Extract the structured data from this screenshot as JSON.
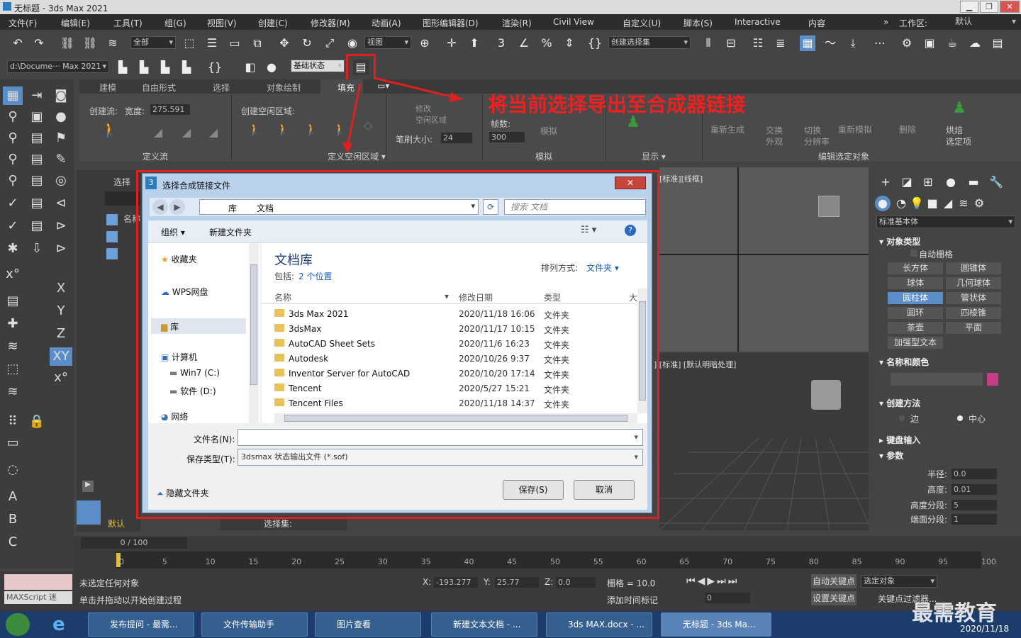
{
  "window": {
    "title": "无标题 - 3ds Max 2021"
  },
  "menu": [
    "文件(F)",
    "编辑(E)",
    "工具(T)",
    "组(G)",
    "视图(V)",
    "创建(C)",
    "修改器(M)",
    "动画(A)",
    "图形编辑器(D)",
    "渲染(R)",
    "Civil View",
    "自定义(U)",
    "脚本(S)",
    "Interactive",
    "内容"
  ],
  "workspace": {
    "label": "工作区:",
    "value": "默认"
  },
  "toolbar1": {
    "filter": "全部",
    "view": "视图",
    "selection_set": "创建选择集"
  },
  "toolbar2": {
    "path": "d:\\Docume··· Max 2021",
    "state": "基础状态"
  },
  "ribbon": {
    "tabs": [
      "建模",
      "自由形式",
      "选择",
      "对象绘制",
      "填充"
    ],
    "create_flow": "创建流:",
    "width_label": "宽度:",
    "width_value": "275.591",
    "create_region": "创建空闲区域:",
    "modify_region": "修改\n空闲区域",
    "brush_label": "笔刷大小:",
    "brush_value": "24",
    "frames_label": "帧数:",
    "frames_value": "300",
    "simulate": "模拟",
    "regen": "重新生成",
    "exchange": "交换\n外观",
    "switch": "切换\n分辨率",
    "resim": "重新模拟",
    "delete": "删除",
    "bake": "烘焙\n选定项",
    "sections": [
      "定义流",
      "定义空闲区域 ▾",
      "模拟",
      "显示 ▾",
      "编辑选定对象"
    ]
  },
  "annotation": "将当前选择导出至合成器链接",
  "dialog": {
    "title": "选择合成链接文件",
    "address": [
      "库",
      "文档"
    ],
    "search_placeholder": "搜索 文档",
    "organize": "组织 ▾",
    "new_folder": "新建文件夹",
    "nav": [
      "收藏夹",
      "WPS网盘",
      "库",
      "计算机",
      "Win7 (C:)",
      "软件 (D:)",
      "网络"
    ],
    "library_title": "文档库",
    "library_includes": "包括:",
    "library_locations": "2 个位置",
    "sort_label": "排列方式:",
    "sort_value": "文件夹 ▾",
    "columns": [
      "名称",
      "修改日期",
      "类型",
      "大"
    ],
    "files": [
      {
        "name": "3ds Max 2021",
        "date": "2020/11/18 16:06",
        "type": "文件夹"
      },
      {
        "name": "3dsMax",
        "date": "2020/11/17 10:15",
        "type": "文件夹"
      },
      {
        "name": "AutoCAD Sheet Sets",
        "date": "2020/11/6 16:23",
        "type": "文件夹"
      },
      {
        "name": "Autodesk",
        "date": "2020/10/26 9:37",
        "type": "文件夹"
      },
      {
        "name": "Inventor Server for AutoCAD",
        "date": "2020/10/20 17:14",
        "type": "文件夹"
      },
      {
        "name": "Tencent",
        "date": "2020/5/27 15:21",
        "type": "文件夹"
      },
      {
        "name": "Tencent Files",
        "date": "2020/11/18 14:37",
        "type": "文件夹"
      }
    ],
    "filename_label": "文件名(N):",
    "filename_value": "",
    "filetype_label": "保存类型(T):",
    "filetype_value": "3dsmax 状态输出文件 (*.sof)",
    "hide_folders": "隐藏文件夹",
    "save": "保存(S)",
    "cancel": "取消"
  },
  "scene_explorer": {
    "select": "选择",
    "name": "名称",
    "layer": "默认",
    "selset": "选择集:"
  },
  "viewports": {
    "top_label": "[标准][线框]",
    "persp_label": "] [标准] [默认明暗处理]"
  },
  "command_panel": {
    "dropdown": "标准基本体",
    "object_type": "对象类型",
    "autogrid": "自动栅格",
    "buttons": [
      "长方体",
      "圆锥体",
      "球体",
      "几何球体",
      "圆柱体",
      "管状体",
      "圆环",
      "四棱锥",
      "茶壶",
      "平面",
      "加强型文本"
    ],
    "name_color": "名称和颜色",
    "creation_method": "创建方法",
    "edge": "边",
    "center": "中心",
    "keyboard": "键盘输入",
    "params": "参数",
    "radius_label": "半径:",
    "radius": "0.0",
    "height_label": "高度:",
    "height": "0.01",
    "hseg_label": "高度分段:",
    "hseg": "5",
    "cseg_label": "端面分段:",
    "cseg": "1"
  },
  "timeline": {
    "frame": "0 / 100",
    "ticks": [
      "0",
      "5",
      "10",
      "15",
      "20",
      "25",
      "30",
      "35",
      "40",
      "45",
      "50",
      "55",
      "60",
      "65",
      "70",
      "75",
      "80",
      "85",
      "90",
      "95",
      "100"
    ]
  },
  "status": {
    "maxscript": "MAXScript 迷",
    "line1": "未选定任何对象",
    "line2": "单击并拖动以开始创建过程",
    "x": "-193.277",
    "y": "25.77",
    "z": "0.0",
    "grid": "栅格 = 10.0",
    "add_time_tag": "添加时间标记",
    "auto_key": "自动关键点",
    "selected": "选定对象",
    "set_key": "设置关键点",
    "key_filter": "关键点过滤器...",
    "frame_field": "0"
  },
  "taskbar": {
    "tasks": [
      "发布提问 - 最需...",
      "文件传输助手",
      "图片查看",
      "新建文本文档 - ...",
      "3ds MAX.docx - ...",
      "无标题 - 3ds Ma..."
    ],
    "date": "2020/11/18"
  },
  "watermark": "最需教育"
}
